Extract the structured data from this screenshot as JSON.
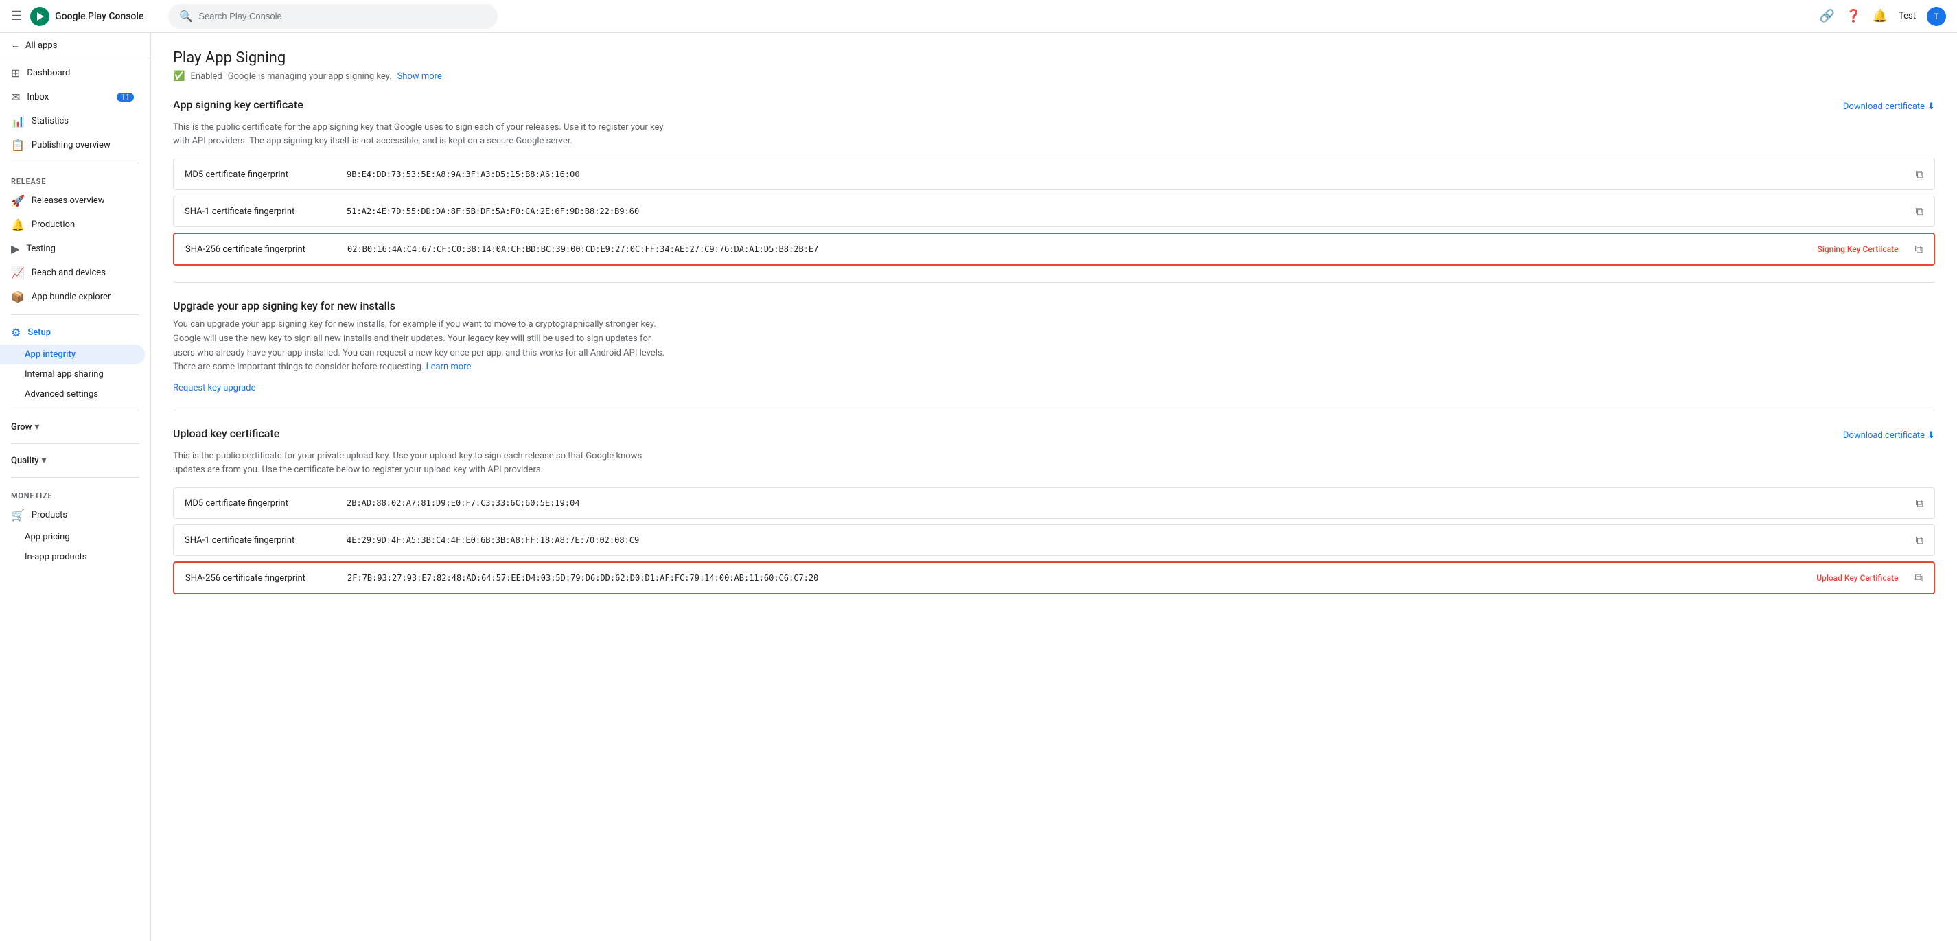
{
  "topNav": {
    "logoText": "Google Play Console",
    "searchPlaceholder": "Search Play Console",
    "testLabel": "Test",
    "linkIconTitle": "Link",
    "helpIconTitle": "Help",
    "notifIconTitle": "Notifications",
    "avatarInitial": "T"
  },
  "sidebar": {
    "allApps": "All apps",
    "items": [
      {
        "id": "dashboard",
        "label": "Dashboard",
        "icon": "⊞"
      },
      {
        "id": "inbox",
        "label": "Inbox",
        "icon": "✉",
        "badge": "11"
      },
      {
        "id": "statistics",
        "label": "Statistics",
        "icon": "📊"
      },
      {
        "id": "publishing",
        "label": "Publishing overview",
        "icon": "📋"
      }
    ],
    "releaseSection": "Release",
    "releaseItems": [
      {
        "id": "releases-overview",
        "label": "Releases overview",
        "icon": "🚀"
      },
      {
        "id": "production",
        "label": "Production",
        "icon": "🔔"
      },
      {
        "id": "testing",
        "label": "Testing",
        "icon": "▶"
      },
      {
        "id": "reach-devices",
        "label": "Reach and devices",
        "icon": "📈"
      },
      {
        "id": "app-bundle",
        "label": "App bundle explorer",
        "icon": "📦"
      }
    ],
    "setupLabel": "Setup",
    "setupSubItems": [
      {
        "id": "app-integrity",
        "label": "App integrity",
        "active": true
      },
      {
        "id": "internal-sharing",
        "label": "Internal app sharing"
      },
      {
        "id": "advanced-settings",
        "label": "Advanced settings"
      }
    ],
    "growLabel": "Grow",
    "qualityLabel": "Quality",
    "monetizeLabel": "Monetize",
    "monetizeItems": [
      {
        "id": "products",
        "label": "Products",
        "icon": "🛒"
      },
      {
        "id": "app-pricing",
        "label": "App pricing"
      },
      {
        "id": "in-app-products",
        "label": "In-app products"
      }
    ]
  },
  "main": {
    "pageTitle": "Play App Signing",
    "enabledText": "Enabled",
    "managingText": "Google is managing your app signing key.",
    "showMore": "Show more",
    "appSigningCert": {
      "sectionTitle": "App signing key certificate",
      "sectionDesc": "This is the public certificate for the app signing key that Google uses to sign each of your releases. Use it to register your key with API providers. The app signing key itself is not accessible, and is kept on a secure Google server.",
      "downloadBtn": "Download certificate",
      "rows": [
        {
          "label": "MD5 certificate fingerprint",
          "value": "9B:E4:DD:73:53:5E:A8:9A:3F:A3:D5:15:B8:A6:16:00",
          "highlighted": false,
          "tag": ""
        },
        {
          "label": "SHA-1 certificate fingerprint",
          "value": "51:A2:4E:7D:55:DD:DA:8F:5B:DF:5A:F0:CA:2E:6F:9D:B8:22:B9:60",
          "highlighted": false,
          "tag": ""
        },
        {
          "label": "SHA-256 certificate fingerprint",
          "value": "02:B0:16:4A:C4:67:CF:C0:38:14:0A:CF:BD:BC:39:00:CD:E9:27:0C:FF:34:AE:27:C9:76:DA:A1:D5:B8:2B:E7",
          "highlighted": true,
          "tag": "Signing Key Certiicate"
        }
      ]
    },
    "upgradeSection": {
      "title": "Upgrade your app signing key for new installs",
      "desc": "You can upgrade your app signing key for new installs, for example if you want to move to a cryptographically stronger key. Google will use the new key to sign all new installs and their updates. Your legacy key will still be used to sign updates for users who already have your app installed. You can request a new key once per app, and this works for all Android API levels. There are some important things to consider before requesting.",
      "learnMore": "Learn more",
      "requestLink": "Request key upgrade"
    },
    "uploadKeyCert": {
      "sectionTitle": "Upload key certificate",
      "sectionDesc": "This is the public certificate for your private upload key. Use your upload key to sign each release so that Google knows updates are from you. Use the certificate below to register your upload key with API providers.",
      "downloadBtn": "Download certificate",
      "rows": [
        {
          "label": "MD5 certificate fingerprint",
          "value": "2B:AD:88:02:A7:81:D9:E0:F7:C3:33:6C:60:5E:19:04",
          "highlighted": false,
          "tag": ""
        },
        {
          "label": "SHA-1 certificate fingerprint",
          "value": "4E:29:9D:4F:A5:3B:C4:4F:E0:6B:3B:A8:FF:18:A8:7E:70:02:08:C9",
          "highlighted": false,
          "tag": ""
        },
        {
          "label": "SHA-256 certificate fingerprint",
          "value": "2F:7B:93:27:93:E7:82:48:AD:64:57:EE:D4:03:5D:79:D6:DD:62:D0:D1:AF:FC:79:14:00:AB:11:60:C6:C7:20",
          "highlighted": true,
          "tag": "Upload Key Certificate"
        }
      ]
    }
  }
}
